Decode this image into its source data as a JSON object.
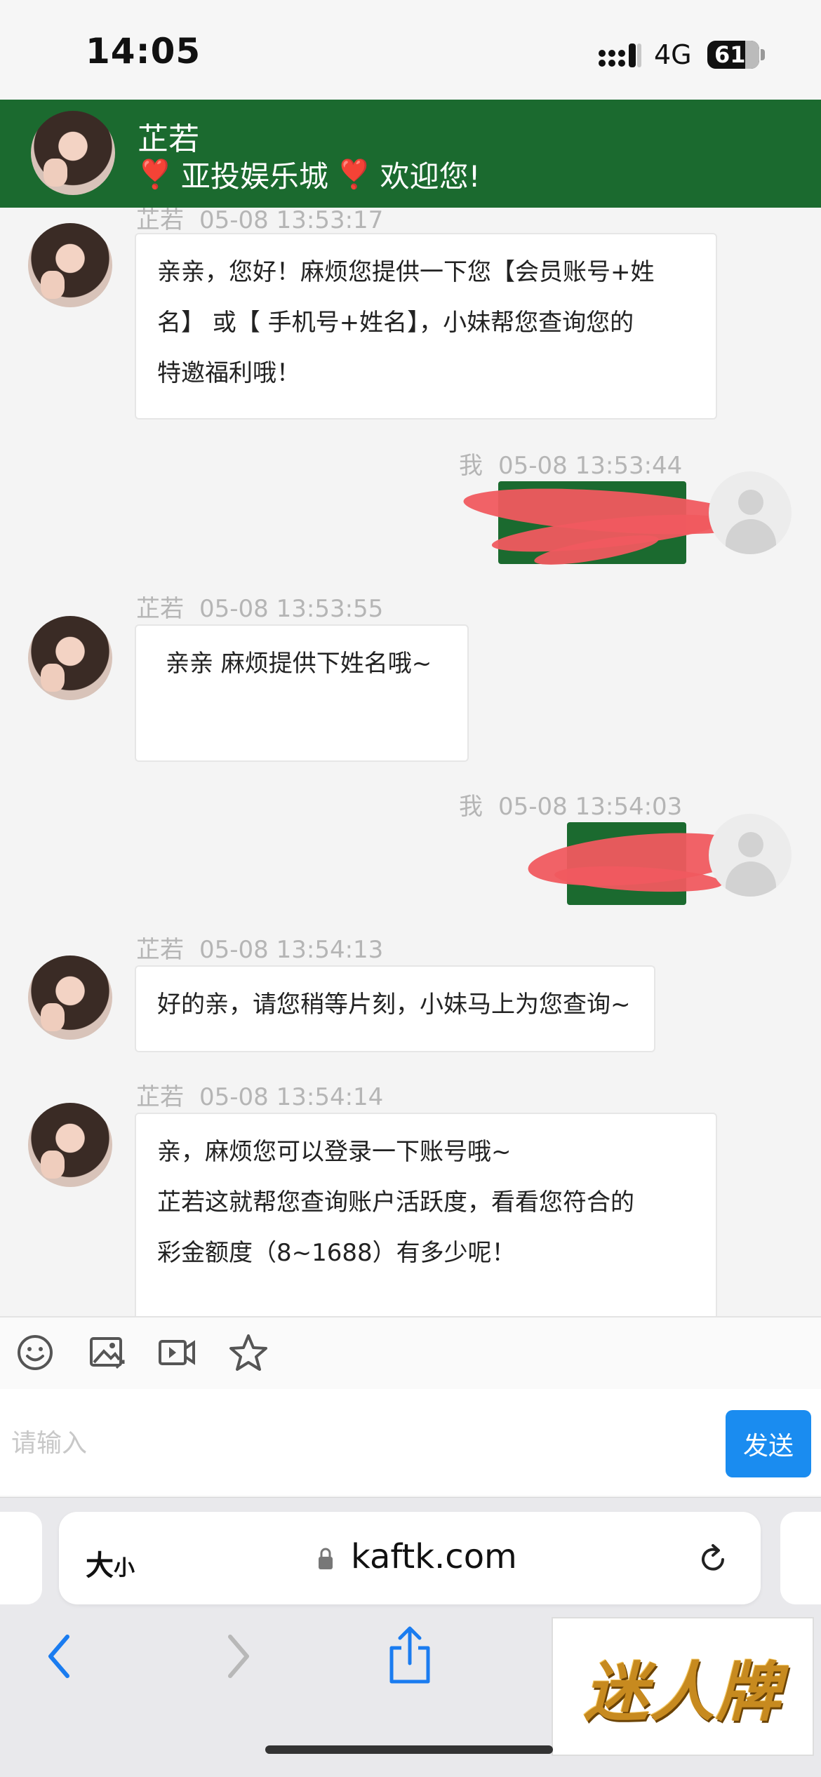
{
  "status_bar": {
    "time": "14:05",
    "network": "4G",
    "battery": "61"
  },
  "chat_header": {
    "agent_name": "芷若",
    "welcome_heart": "❣️",
    "welcome_text": "亚投娱乐城",
    "welcome_suffix": "欢迎您!"
  },
  "messages": [
    {
      "sender": "芷若",
      "time": "05-08 13:53:17",
      "direction": "incoming",
      "lines": [
        "亲亲，您好！麻烦您提供一下您【会员账号+姓",
        "名】 或【 手机号+姓名】，小妹帮您查询您的",
        "特邀福利哦！"
      ]
    },
    {
      "sender": "我",
      "time": "05-08 13:53:44",
      "direction": "outgoing",
      "redacted": true
    },
    {
      "sender": "芷若",
      "time": "05-08 13:53:55",
      "direction": "incoming",
      "lines": [
        "亲亲 麻烦提供下姓名哦~"
      ]
    },
    {
      "sender": "我",
      "time": "05-08 13:54:03",
      "direction": "outgoing",
      "redacted": true
    },
    {
      "sender": "芷若",
      "time": "05-08 13:54:13",
      "direction": "incoming",
      "lines": [
        "好的亲，请您稍等片刻，小妹马上为您查询~"
      ]
    },
    {
      "sender": "芷若",
      "time": "05-08 13:54:14",
      "direction": "incoming",
      "lines": [
        "亲，麻烦您可以登录一下账号哦~",
        "芷若这就帮您查询账户活跃度，看看您符合的",
        "彩金额度（8~1688）有多少呢！"
      ]
    }
  ],
  "toolbar": {
    "icons": [
      "emoji-icon",
      "image-icon",
      "video-icon",
      "star-icon"
    ]
  },
  "composer": {
    "placeholder": "请输入",
    "send_label": "发送"
  },
  "browser": {
    "text_size_label_big": "大",
    "text_size_label_small": "小",
    "url": "kaftk.com"
  },
  "watermark": "迷人牌",
  "colors": {
    "header_green": "#1b6a2f",
    "send_blue": "#1a8cf0",
    "redaction": "#f05a5f"
  }
}
